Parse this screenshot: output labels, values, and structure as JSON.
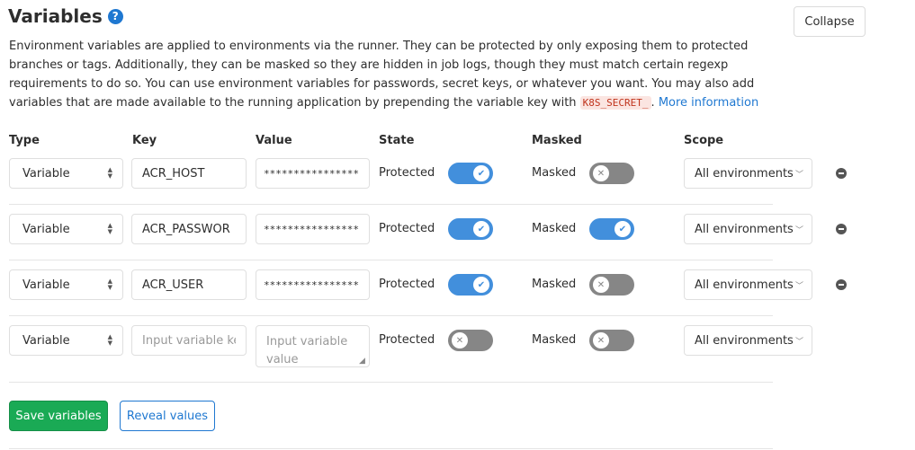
{
  "section": {
    "title": "Variables",
    "help_icon": "question-circle-icon",
    "collapse_label": "Collapse",
    "description_main": "Environment variables are applied to environments via the runner. They can be protected by only exposing them to protected branches or tags. Additionally, they can be masked so they are hidden in job logs, though they must match certain regexp requirements to do so. You can use environment variables for passwords, secret keys, or whatever you want. You may also add variables that are made available to the running application by prepending the variable key with",
    "description_code": "K8S_SECRET_",
    "description_after": ".",
    "more_info_link": "More information"
  },
  "columns": {
    "type": "Type",
    "key": "Key",
    "value": "Value",
    "state": "State",
    "masked": "Masked",
    "scope": "Scope"
  },
  "rows": [
    {
      "type": "Variable",
      "key": "ACR_HOST",
      "value": "****************",
      "protected_label": "Protected",
      "protected": true,
      "masked_label": "Masked",
      "masked": false,
      "scope": "All environments"
    },
    {
      "type": "Variable",
      "key": "ACR_PASSWOR",
      "value": "****************",
      "protected_label": "Protected",
      "protected": true,
      "masked_label": "Masked",
      "masked": true,
      "scope": "All environments"
    },
    {
      "type": "Variable",
      "key": "ACR_USER",
      "value": "****************",
      "protected_label": "Protected",
      "protected": true,
      "masked_label": "Masked",
      "masked": false,
      "scope": "All environments"
    }
  ],
  "new_row": {
    "type": "Variable",
    "key_placeholder": "Input variable key",
    "value_placeholder": "Input variable value",
    "protected_label": "Protected",
    "protected": false,
    "masked_label": "Masked",
    "masked": false,
    "scope": "All environments"
  },
  "actions": {
    "save_label": "Save variables",
    "reveal_label": "Reveal values"
  },
  "colors": {
    "toggle_on": "#428fdc",
    "toggle_off": "#868686",
    "save_button": "#1aaa55",
    "link": "#1f78d1"
  }
}
